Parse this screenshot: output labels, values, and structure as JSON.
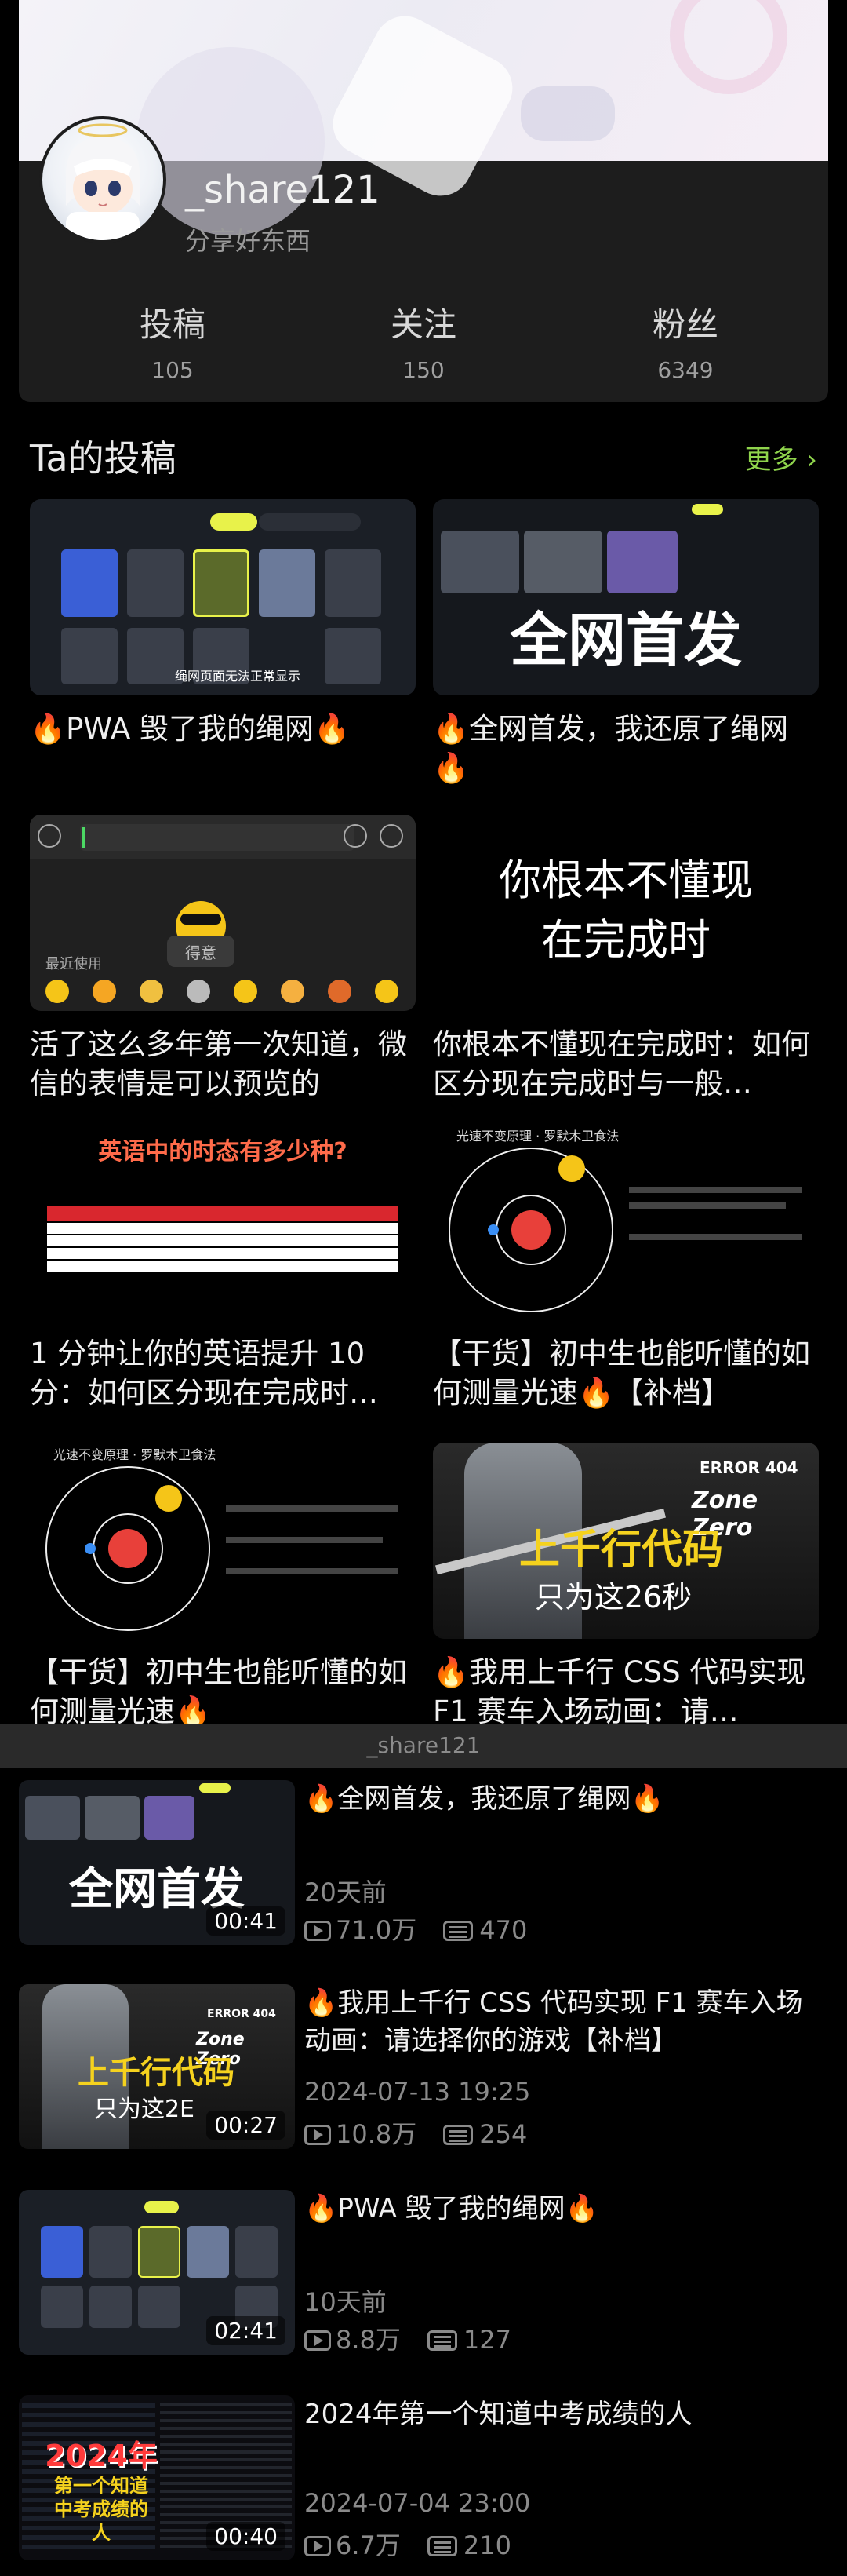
{
  "profile": {
    "username": "_share121",
    "bio": "分享好东西",
    "stats": [
      {
        "label": "投稿",
        "value": "105"
      },
      {
        "label": "关注",
        "value": "150"
      },
      {
        "label": "粉丝",
        "value": "6349"
      }
    ]
  },
  "posts_section": {
    "title": "Ta的投稿",
    "more_label": "更多 ›"
  },
  "grid": [
    {
      "title": "🔥PWA 毁了我的绳网🔥",
      "thumb_text": "绳网页面无法正常显示"
    },
    {
      "title": "🔥全网首发，我还原了绳网🔥",
      "thumb_text": "全网首发"
    },
    {
      "title": "活了这么多年第一次知道，微信的表情是可以预览的",
      "thumb_text": "得意",
      "thumb_sub": "最近使用"
    },
    {
      "title": "你根本不懂现在完成时：如何区分现在完成时与一般…",
      "thumb_text": "你根本不懂现在完成时"
    },
    {
      "title": "1 分钟让你的英语提升 10 分：如何区分现在完成时…",
      "thumb_text": "英语中的时态有多少种?"
    },
    {
      "title": "【干货】初中生也能听懂的如何测量光速🔥【补档】",
      "thumb_text": "光速不变原理 · 罗默木卫食法"
    },
    {
      "title": "【干货】初中生也能听懂的如何测量光速🔥",
      "thumb_text": "光速不变原理 · 罗默木卫食法"
    },
    {
      "title": "🔥我用上千行 CSS 代码实现 F1 赛车入场动画：请…",
      "thumb_text": "上千行代码",
      "thumb_sub": "只为这26秒"
    }
  ],
  "sticky_name": "_share121",
  "list": [
    {
      "title": "🔥全网首发，我还原了绳网🔥",
      "date": "20天前",
      "views": "71.0万",
      "comments": "470",
      "duration": "00:41",
      "thumb_text": "全网首发"
    },
    {
      "title": "🔥我用上千行 CSS 代码实现 F1 赛车入场动画：请选择你的游戏【补档】",
      "date": "2024-07-13 19:25",
      "views": "10.8万",
      "comments": "254",
      "duration": "00:27",
      "thumb_text": "上千行代码",
      "thumb_sub": "只为这2E"
    },
    {
      "title": "🔥PWA 毁了我的绳网🔥",
      "date": "10天前",
      "views": "8.8万",
      "comments": "127",
      "duration": "02:41",
      "thumb_text": ""
    },
    {
      "title": "2024年第一个知道中考成绩的人",
      "date": "2024-07-04 23:00",
      "views": "6.7万",
      "comments": "210",
      "duration": "00:40",
      "thumb_text": "2024年",
      "thumb_sub": "第一个知道中考成绩的人"
    }
  ],
  "colors": {
    "accent": "#8fd44c",
    "card": "#1d1d1d",
    "muted": "#8a8a8a"
  }
}
